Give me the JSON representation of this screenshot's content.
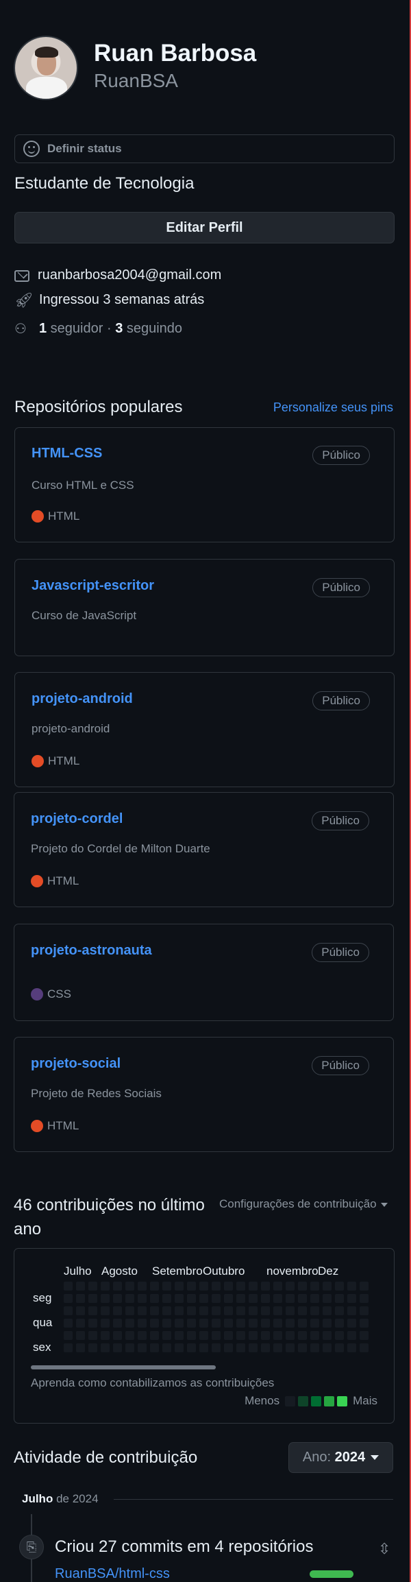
{
  "profile": {
    "name": "Ruan Barbosa",
    "login": "RuanBSA",
    "status_label": "Definir status",
    "bio": "Estudante de Tecnologia",
    "edit_label": "Editar Perfil",
    "email": "ruanbarbosa2004@gmail.com",
    "joined": "Ingressou 3 semanas atrás",
    "followers_count": "1",
    "followers_label": " seguidor · ",
    "following_count": "3",
    "following_label": " seguindo"
  },
  "popular": {
    "title": "Repositórios populares",
    "customize_label": "Personalize seus pins",
    "repos": [
      {
        "name": "HTML-CSS",
        "visibility": "Público",
        "description": "Curso HTML e CSS",
        "language": "HTML",
        "language_color": "#e34c26"
      },
      {
        "name": "Javascript-escritor",
        "visibility": "Público",
        "description": "Curso de JavaScript",
        "language": "",
        "language_color": ""
      },
      {
        "name": "projeto-android",
        "visibility": "Público",
        "description": "projeto-android",
        "language": "HTML",
        "language_color": "#e34c26"
      },
      {
        "name": "projeto-cordel",
        "visibility": "Público",
        "description": "Projeto do Cordel de Milton Duarte",
        "language": "HTML",
        "language_color": "#e34c26"
      },
      {
        "name": "projeto-astronauta",
        "visibility": "Público",
        "description": "",
        "language": "CSS",
        "language_color": "#563d7c"
      },
      {
        "name": "projeto-social",
        "visibility": "Público",
        "description": "Projeto de Redes Sociais",
        "language": "HTML",
        "language_color": "#e34c26"
      }
    ]
  },
  "contributions": {
    "title": "46 contribuições no último ano",
    "settings_label": "Configurações de contribuição",
    "months": [
      "Julho",
      "Agosto",
      "Setembro",
      "Outubro",
      "novembro",
      "Dez"
    ],
    "days": [
      "seg",
      "qua",
      "sex"
    ],
    "learn_label": "Aprenda como contabilizamos as contribuições",
    "legend_less": "Menos",
    "legend_more": "Mais",
    "legend_colors": [
      "#161b22",
      "#0e4429",
      "#006d32",
      "#26a641",
      "#39d353"
    ]
  },
  "activity": {
    "title": "Atividade de contribuição",
    "year_prefix": "Ano: ",
    "year": "2024",
    "month_bold": "Julho",
    "month_rest": " de 2024",
    "commit_text": "Criou 27 commits em 4 repositórios",
    "repo_link": "RuanBSA/html-css"
  }
}
